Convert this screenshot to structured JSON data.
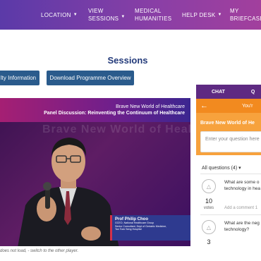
{
  "nav": {
    "items": [
      {
        "lines": [
          "LOCATION"
        ],
        "caret": true
      },
      {
        "lines": [
          "VIEW",
          "SESSIONS"
        ],
        "caret": true
      },
      {
        "lines": [
          "MEDICAL",
          "HUMANITIES"
        ],
        "caret": false
      },
      {
        "lines": [
          "HELP DESK"
        ],
        "caret": true
      },
      {
        "lines": [
          "MY",
          "BRIEFCASE"
        ],
        "caret": false
      }
    ]
  },
  "page": {
    "title": "Sessions",
    "buttons": {
      "faculty_info": "lty Information",
      "download_overview": "Download Programme Overview"
    }
  },
  "video": {
    "banner_line1": "Brave New World of Healthcare",
    "banner_line2": "Panel Discussion: Reinventing the Continuum of Healthcare",
    "background_text": "Brave New World of Healthcare",
    "speaker_name": "Prof Philip Choo",
    "speaker_role1": "GCEO, National Healthcare Group",
    "speaker_role2": "Senior Consultant, Dept of Geriatric Medicine,",
    "speaker_role3": "Tan Tock Seng Hospital",
    "note": "does not load, - switch to the other player."
  },
  "chat": {
    "tab_chat": "CHAT",
    "tab_qa": "Q",
    "back_arrow": "←",
    "header_text": "You'r",
    "session_title": "Brave New World of He",
    "input_placeholder": "Enter your question here",
    "filter_label": "All questions (4)",
    "filter_caret": "▾",
    "questions": [
      {
        "votes": "10",
        "votes_label": "votes",
        "text1": "What are some o",
        "text2": "technology in hea",
        "comment": "Add a comment 1"
      },
      {
        "votes": "3",
        "votes_label": "",
        "text1": "What are the neg",
        "text2": "technology?",
        "comment": ""
      }
    ]
  },
  "colors": {
    "nav_start": "#5b3aa8",
    "nav_end": "#a23f9d",
    "title": "#233a7a",
    "button": "#2a5b8c",
    "chat_tabs": "#5e2a82",
    "orange": "#f28a1f"
  }
}
